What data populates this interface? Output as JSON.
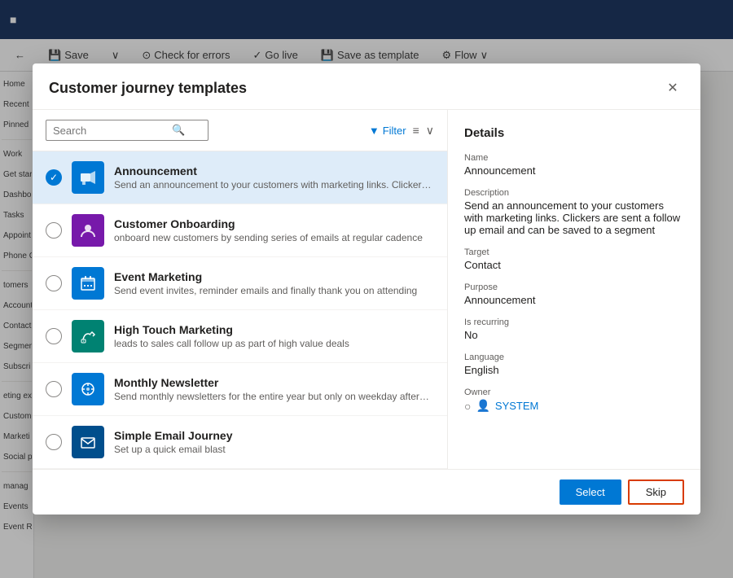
{
  "app": {
    "header": {
      "toolbar": {
        "back_label": "←",
        "save_label": "Save",
        "check_errors_label": "Check for errors",
        "go_live_label": "Go live",
        "save_template_label": "Save as template",
        "flow_label": "Flow"
      }
    },
    "sidebar": {
      "items": [
        "Home",
        "Recent",
        "Pinned",
        "Work",
        "Get start",
        "Dashbo",
        "Tasks",
        "Appoint",
        "Phone C",
        "tomers",
        "Account",
        "Contact",
        "Segmen",
        "Subscri",
        "eting ex",
        "Custome",
        "Marketi",
        "Social p",
        "manag",
        "Events",
        "Event Re"
      ]
    }
  },
  "dialog": {
    "title": "Customer journey templates",
    "close_label": "✕",
    "search": {
      "placeholder": "Search",
      "icon": "🔍"
    },
    "filter": {
      "label": "Filter",
      "icon": "▼"
    },
    "templates": [
      {
        "id": "announcement",
        "name": "Announcement",
        "description": "Send an announcement to your customers with marketing links. Clickers are sent a...",
        "icon_char": "📢",
        "icon_class": "icon-blue",
        "icon_symbol": "≡",
        "selected": true
      },
      {
        "id": "customer-onboarding",
        "name": "Customer Onboarding",
        "description": "onboard new customers by sending series of emails at regular cadence",
        "icon_char": "👤",
        "icon_class": "icon-purple",
        "icon_symbol": "☺",
        "selected": false
      },
      {
        "id": "event-marketing",
        "name": "Event Marketing",
        "description": "Send event invites, reminder emails and finally thank you on attending",
        "icon_char": "📅",
        "icon_class": "icon-blue",
        "icon_symbol": "▦",
        "selected": false
      },
      {
        "id": "high-touch",
        "name": "High Touch Marketing",
        "description": "leads to sales call follow up as part of high value deals",
        "icon_char": "📞",
        "icon_class": "icon-cyan",
        "icon_symbol": "✆",
        "selected": false
      },
      {
        "id": "monthly-newsletter",
        "name": "Monthly Newsletter",
        "description": "Send monthly newsletters for the entire year but only on weekday afternoons",
        "icon_char": "🔄",
        "icon_class": "icon-blue",
        "icon_symbol": "↺",
        "selected": false
      },
      {
        "id": "simple-email",
        "name": "Simple Email Journey",
        "description": "Set up a quick email blast",
        "icon_char": "✉",
        "icon_class": "icon-navy",
        "icon_symbol": "✉",
        "selected": false
      }
    ],
    "details": {
      "section_title": "Details",
      "name_label": "Name",
      "name_value": "Announcement",
      "description_label": "Description",
      "description_value": "Send an announcement to your customers with marketing links. Clickers are sent a follow up email and can be saved to a segment",
      "target_label": "Target",
      "target_value": "Contact",
      "purpose_label": "Purpose",
      "purpose_value": "Announcement",
      "recurring_label": "Is recurring",
      "recurring_value": "No",
      "language_label": "Language",
      "language_value": "English",
      "owner_label": "Owner",
      "owner_value": "SYSTEM"
    },
    "footer": {
      "select_label": "Select",
      "skip_label": "Skip"
    }
  }
}
